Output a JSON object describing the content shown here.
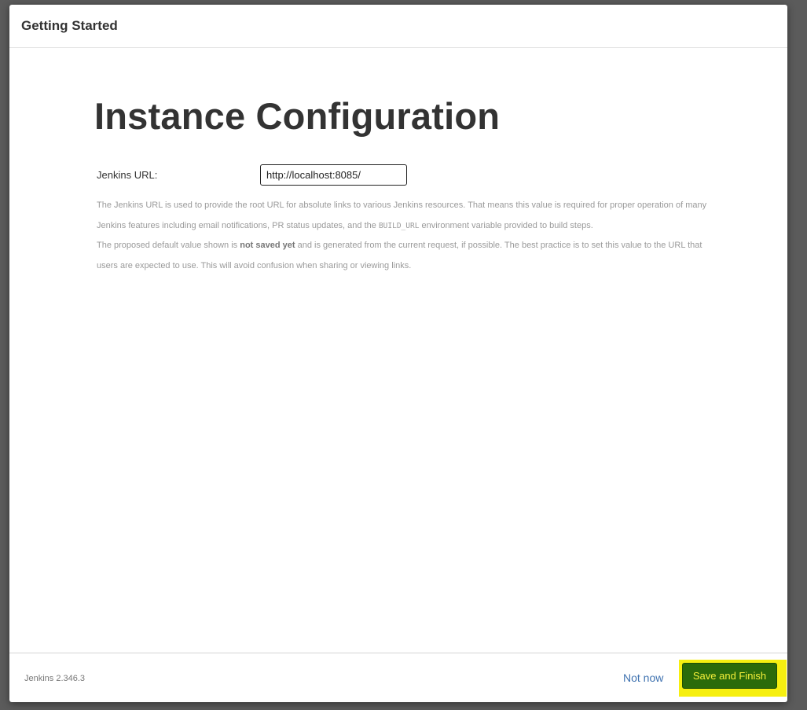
{
  "dialog": {
    "title": "Getting Started"
  },
  "page": {
    "heading": "Instance Configuration"
  },
  "form": {
    "url_label": "Jenkins URL:",
    "url_value": "http://localhost:8085/"
  },
  "help": {
    "para1_part1": "The Jenkins URL is used to provide the root URL for absolute links to various Jenkins resources. That means this value is required for proper operation of many Jenkins features including email notifications, PR status updates, and the ",
    "para1_code": "BUILD_URL",
    "para1_part2": " environment variable provided to build steps.",
    "para2_part1": "The proposed default value shown is ",
    "para2_strong": "not saved yet",
    "para2_part2": " and is generated from the current request, if possible. The best practice is to set this value to the URL that users are expected to use. This will avoid confusion when sharing or viewing links."
  },
  "footer": {
    "version": "Jenkins 2.346.3",
    "not_now_label": "Not now",
    "save_label": "Save and Finish"
  },
  "colors": {
    "save_button_bg": "#2b6b0a",
    "save_button_text": "#f5ef3a",
    "highlight": "#f6ef10",
    "link": "#3f72b0"
  }
}
